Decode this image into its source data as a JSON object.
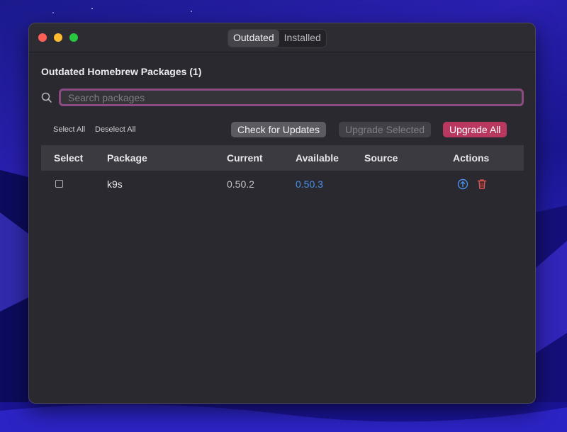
{
  "window": {
    "tabs": [
      {
        "label": "Outdated",
        "active": true
      },
      {
        "label": "Installed",
        "active": false
      }
    ]
  },
  "main": {
    "heading": "Outdated Homebrew Packages (1)",
    "search": {
      "placeholder": "Search packages",
      "value": ""
    },
    "select_all_label": "Select All",
    "deselect_all_label": "Deselect All",
    "check_updates_label": "Check for Updates",
    "upgrade_selected_label": "Upgrade Selected",
    "upgrade_all_label": "Upgrade All"
  },
  "table": {
    "columns": [
      "Select",
      "Package",
      "Current",
      "Available",
      "Source",
      "Actions"
    ],
    "rows": [
      {
        "checked": false,
        "package": "k9s",
        "current": "0.50.2",
        "available": "0.50.3",
        "source": ""
      }
    ]
  },
  "colors": {
    "accent": "#b8385f",
    "available_text": "#4a8fe7",
    "upgrade_icon": "#4a8fe7",
    "delete_icon": "#e0524f",
    "search_border": "#8a4b83"
  },
  "icons": {
    "search": "search-icon",
    "upgrade": "arrow-up-circle-icon",
    "delete": "trash-icon"
  }
}
